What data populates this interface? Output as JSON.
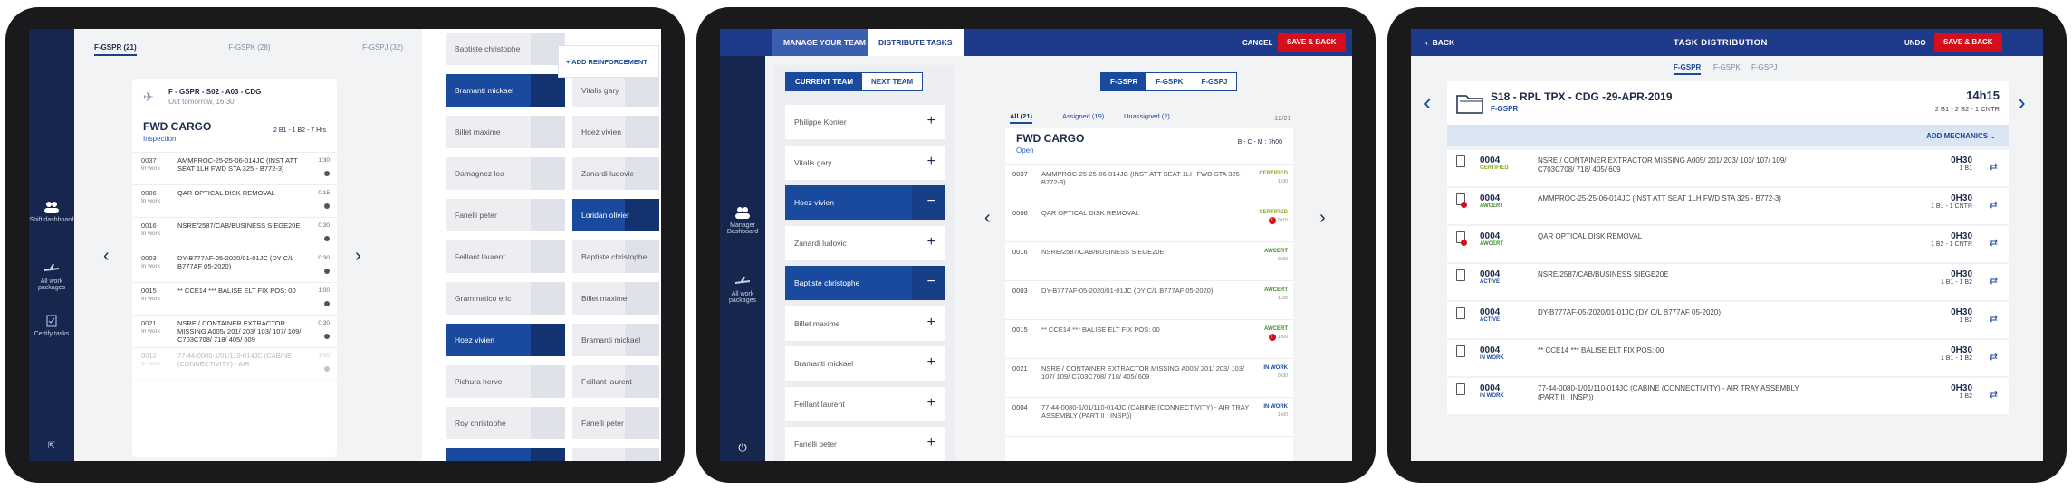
{
  "t1": {
    "tabs": [
      "F-GSPR (21)",
      "F-GSPK (28)",
      "F-GSPJ (32)"
    ],
    "side": [
      "Shift dashboard",
      "All work packages",
      "Certify tasks"
    ],
    "ac_line": "F - GSPR - S02 - A03 - CDG",
    "ac_sub": "Out tomorrow, 16:30",
    "card_title": "FWD CARGO",
    "card_status": "Inspection",
    "card_req": "2 B1 - 1 B2 - 7 Hrs",
    "tasks": [
      {
        "c": "0037",
        "s": "In work",
        "d": "AMMPROC-25-25-06-014JC (INST ATT SEAT 1LH FWD STA 325 - B772-3)",
        "t": "1:30"
      },
      {
        "c": "0006",
        "s": "In work",
        "d": "QAR OPTICAL DISK REMOVAL",
        "t": "0:15"
      },
      {
        "c": "0016",
        "s": "In work",
        "d": "NSRE/2587/CAB/BUSINESS SIEGE20E",
        "t": "0:30"
      },
      {
        "c": "0003",
        "s": "In work",
        "d": "DY-B777AF-05-2020/01-01JC (DY C/L B777AF 05-2020)",
        "t": "0:30"
      },
      {
        "c": "0015",
        "s": "In work",
        "d": "** CCE14 *** BALISE ELT FIX POS: 00",
        "t": "1:00"
      },
      {
        "c": "0021",
        "s": "In work",
        "d": "NSRE / CONTAINER EXTRACTOR MISSING A005/ 201/ 203/ 103/ 107/ 109/ C703C708/ 718/ 405/ 609",
        "t": "0:30"
      },
      {
        "c": "0012",
        "s": "In work",
        "d": "77-44-0080-1/01/110-014JC (CABINE (CONNECTIVITY) - AIR",
        "t": "1:00"
      }
    ],
    "reinforce": "+ ADD REINFORCEMENT",
    "col1": [
      "Baptiste christophe",
      "Bramanti mickael",
      "Billet maxime",
      "Damagnez lea",
      "Fanelli peter",
      "Feillant laurent",
      "Grammatico eric",
      "Hoez vivien",
      "Pichura herve",
      "Roy christophe",
      "Loridan olivier"
    ],
    "col2": [
      "Vitalis gary",
      "Hoez vivien",
      "Zanardi ludovic",
      "Loridan olivier",
      "Baptiste christophe",
      "Billet maxime",
      "Bramanti mickael",
      "Feillant laurent",
      "Fanelli peter",
      "Damagnez lea"
    ]
  },
  "t2": {
    "tab_manage": "MANAGE YOUR TEAM",
    "tab_dist": "DISTRIBUTE TASKS",
    "cancel": "CANCEL",
    "save": "SAVE & BACK",
    "side": [
      "Manager Dashboard",
      "All work packages"
    ],
    "seg": [
      "CURRENT TEAM",
      "NEXT TEAM"
    ],
    "members": [
      "Philippe Konter",
      "Vitalis gary",
      "Hoez vivien",
      "Zanardi ludovic",
      "Baptiste christophe",
      "Billet maxime",
      "Bramanti mickael",
      "Feillant laurent",
      "Fanelli peter"
    ],
    "aircraft": [
      "F-GSPR",
      "F-GSPK",
      "F-GSPJ"
    ],
    "filters": [
      "All (21)",
      "Assigned (19)",
      "Unassigned (2)"
    ],
    "count": "12/21",
    "card_title": "FWD CARGO",
    "card_status": "Open",
    "card_req": "B - C - M : 7h00",
    "tasks": [
      {
        "c": "0037",
        "d": "AMMPROC-25-25-06-014JC (INST ATT SEAT 1LH FWD STA 325 - B772-3)",
        "s": "CERTIFIED",
        "t": "1h30"
      },
      {
        "c": "0006",
        "d": "QAR OPTICAL DISK REMOVAL",
        "s": "CERTIFIED",
        "t": "0h15"
      },
      {
        "c": "0016",
        "d": "NSRE/2587/CAB/BUSINESS SIEGE20E",
        "s": "AWCERT",
        "t": "0h30"
      },
      {
        "c": "0003",
        "d": "DY-B777AF-05-2020/01-01JC (DY C/L B777AF 05-2020)",
        "s": "AWCERT",
        "t": "1h30"
      },
      {
        "c": "0015",
        "d": "** CCE14 *** BALISE ELT FIX POS: 00",
        "s": "AWCERT",
        "t": "1h00"
      },
      {
        "c": "0021",
        "d": "NSRE / CONTAINER EXTRACTOR MISSING A005/ 201/ 203/ 103/ 107/ 109/ C703C708/ 718/ 405/ 609",
        "s": "IN WORK",
        "t": "0h30"
      },
      {
        "c": "0004",
        "d": "77-44-0080-1/01/110-014JC (CABINE (CONNECTIVITY) - AIR TRAY ASSEMBLY (PART II : INSP.))",
        "s": "IN WORK",
        "t": "1h00"
      }
    ]
  },
  "t3": {
    "back": "BACK",
    "title": "TASK DISTRIBUTION",
    "undo": "UNDO",
    "save": "SAVE & BACK",
    "aircraft": [
      "F-GSPR",
      "F-GSPK",
      "F-GSPJ"
    ],
    "wp_title": "S18 - RPL TPX - CDG -29-APR-2019",
    "wp_ac": "F-GSPR",
    "wp_dur": "14h15",
    "wp_req": "2 B1 - 2 B2 - 1 CNTR",
    "add_mech": "ADD MECHANICS",
    "tasks": [
      {
        "c": "0004",
        "s": "CERTIFIED",
        "d": "NSRE / CONTAINER EXTRACTOR MISSING A005/ 201/ 203/ 103/ 107/ 109/ C703C708/ 718/ 405/ 609",
        "dur": "0H30",
        "req": "1 B1",
        "red": false
      },
      {
        "c": "0004",
        "s": "AWCERT",
        "d": "AMMPROC-25-25-06-014JC (INST ATT SEAT 1LH FWD STA 325 - B772-3)",
        "dur": "0H30",
        "req": "1 B1 - 1 CNTR",
        "red": true
      },
      {
        "c": "0004",
        "s": "AWCERT",
        "d": "QAR OPTICAL DISK REMOVAL",
        "dur": "0H30",
        "req": "1 B2 - 1 CNTR",
        "red": true
      },
      {
        "c": "0004",
        "s": "ACTIVE",
        "d": "NSRE/2587/CAB/BUSINESS SIEGE20E",
        "dur": "0H30",
        "req": "1 B1 - 1 B2",
        "red": false
      },
      {
        "c": "0004",
        "s": "ACTIVE",
        "d": "DY-B777AF-05-2020/01-01JC (DY C/L B777AF 05-2020)",
        "dur": "0H30",
        "req": "1 B2",
        "red": false
      },
      {
        "c": "0004",
        "s": "IN WORK",
        "d": "** CCE14 *** BALISE ELT FIX POS: 00",
        "dur": "0H30",
        "req": "1 B1 - 1 B2",
        "red": false
      },
      {
        "c": "0004",
        "s": "IN WORK",
        "d": "77-44-0080-1/01/110-014JC (CABINE (CONNECTIVITY) - AIR TRAY ASSEMBLY (PART II : INSP.))",
        "dur": "0H30",
        "req": "1 B2",
        "red": false
      }
    ]
  }
}
